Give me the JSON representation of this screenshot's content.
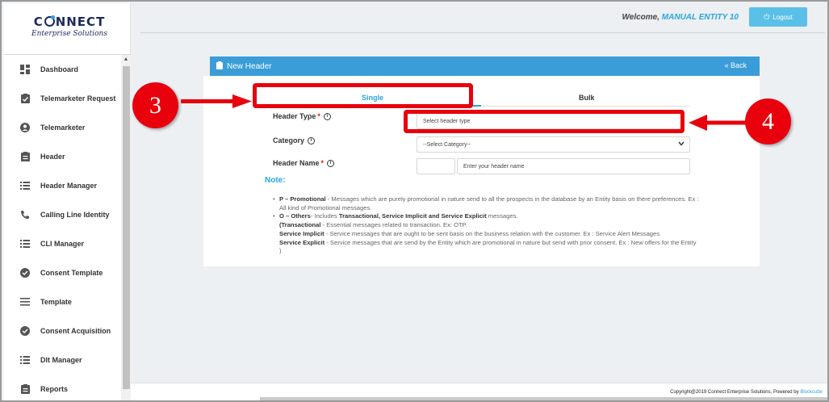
{
  "app": {
    "logo_main_left": "C",
    "logo_main_right": "NNECT",
    "logo_sub": "Enterprise Solutions"
  },
  "header": {
    "welcome_prefix": "Welcome,",
    "welcome_name": "MANUAL ENTITY 10",
    "logout_label": "Logout"
  },
  "sidebar": {
    "items": [
      {
        "label": "Dashboard",
        "icon": "dashboard-icon"
      },
      {
        "label": "Telemarketer Request",
        "icon": "clipboard-check-icon"
      },
      {
        "label": "Telemarketer",
        "icon": "user-circle-icon"
      },
      {
        "label": "Header",
        "icon": "clipboard-icon"
      },
      {
        "label": "Header Manager",
        "icon": "list-icon"
      },
      {
        "label": "Calling Line Identity",
        "icon": "phone-icon"
      },
      {
        "label": "CLI Manager",
        "icon": "list-icon"
      },
      {
        "label": "Consent Template",
        "icon": "check-circle-icon"
      },
      {
        "label": "Template",
        "icon": "lines-icon"
      },
      {
        "label": "Consent Acquisition",
        "icon": "check-circle-icon"
      },
      {
        "label": "Dlt Manager",
        "icon": "list-icon"
      },
      {
        "label": "Reports",
        "icon": "clipboard-icon"
      }
    ]
  },
  "panel": {
    "title": "New Header",
    "back_label": "« Back",
    "tabs": [
      {
        "label": "Single",
        "active": true
      },
      {
        "label": "Bulk",
        "active": false
      }
    ],
    "fields": {
      "header_type_label": "Header Type",
      "header_type_placeholder": "Select header type",
      "category_label": "Category",
      "category_value": "--Select Category--",
      "header_name_label": "Header Name",
      "header_name_placeholder": "Enter your header name"
    },
    "note_title": "Note:",
    "notes": {
      "p_title": "P – Promotional",
      "p_text": " - Messages which are purely promotional in nature send to all the prospects in the database by an Entity basis on there preferences. Ex : All kind of Promotional messages.",
      "o_title": "O – Others",
      "o_text": "- Includes ",
      "o_bold": "Transactional, Service Implicit and Service Explicit",
      "o_tail": " messages.",
      "t_title": "(Transactional",
      "t_text": " - Essential messages related to transaction. Ex: OTP.",
      "si_title": "Service Implicit",
      "si_text": " - Service messages that are ought to be sent basis on the business relation with the customer. Ex : Service Alert Messages",
      "se_title": "Service Explicit",
      "se_text": " - Service messages that are send by the Entity which are promotional in nature but send with prior consent. Ex : New offers for the Entity )"
    }
  },
  "annotations": {
    "step_a": "3",
    "step_b": "4",
    "color": "#e8000c"
  },
  "footer": {
    "text": "Copyright@2019 Connect Enterprise Solutions, Powered by ",
    "brand": "Blockcube"
  }
}
